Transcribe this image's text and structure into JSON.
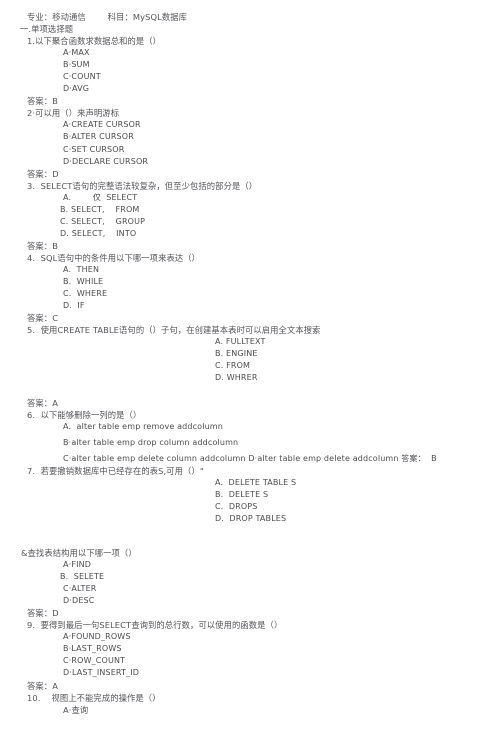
{
  "document": {
    "header": {
      "major_label": "专业：",
      "major_value": "移动通信",
      "subject_label": "科目：",
      "subject_value": "MySQL数据库",
      "full": "专业：移动通信        科目：MySQL数据库"
    },
    "section_title": "一.单项选择题",
    "answer_prefix": "答案：",
    "questions": [
      {
        "number": "1.",
        "stem": "1.以下聚合函数求数据总和的是（）",
        "options": [
          "A·MAX",
          "B·SUM",
          "C·COUNT",
          "D·AVG"
        ],
        "answer_line": "答案：B"
      },
      {
        "number": "2·",
        "stem": "2·可以用（）来声明游标",
        "options": [
          "A·CREATE CURSOR",
          "B·ALTER CURSOR",
          "C·SET CURSOR",
          "D·DECLARE CURSOR"
        ],
        "answer_line": "答案：D"
      },
      {
        "number": "3.",
        "stem": "3.  SELECT语句的完整语法较复杂，但至少包括的部分是（）",
        "options": [
          "A.        仅  SELECT",
          "B. SELECT,    FROM",
          "C. SELECT,    GROUP",
          "D. SELECT,    INTO"
        ],
        "answer_line": "答案：B"
      },
      {
        "number": "4.",
        "stem": "4.  SQL语句中的条件用以下哪一项来表达（）",
        "options": [
          "A.  THEN",
          "B.  WHILE",
          "C.  WHERE",
          "D.  IF"
        ],
        "answer_line": "答案：C"
      },
      {
        "number": "5.",
        "stem": "5.  使用CREATE TABLE语句的（）子句，在创建基本表时可以启用全文本搜索",
        "options": [
          "A. FULLTEXT",
          "B. ENGINE",
          "C. FROM",
          "D. WHRER"
        ],
        "answer_line": "答案：A"
      },
      {
        "number": "6.",
        "stem": "6.  以下能够删除一列的是（）",
        "options": [
          "A.  alter table emp remove addcolumn",
          "B·alter table emp drop column addcolumn",
          "C·alter table emp delete column addcolumn D·alter table emp delete addcolumn 答案：  B"
        ],
        "answer_line": ""
      },
      {
        "number": "7.",
        "stem": "7.  若要撤销数据库中已经存在的表S,可用（）\"",
        "options": [
          "A.  DELETE TABLE S",
          "B.  DELETE S",
          "C.  DROPS",
          "D.  DROP TABLES"
        ],
        "answer_line": ""
      },
      {
        "number": "&",
        "stem": "&查找表结构用以下哪一项（）",
        "options": [
          "A·FIND",
          "B.  SELETE",
          "C·ALTER",
          "D·DESC"
        ],
        "answer_line": "答案：D"
      },
      {
        "number": "9.",
        "stem": "9.  要得到最后一句SELECT查询到的总行数，可以使用的函数是（）",
        "options": [
          "A·FOUND_ROWS",
          "B·LAST_ROWS",
          "C·ROW_COUNT",
          "D·LAST_INSERT_ID"
        ],
        "answer_line": "答案：A"
      },
      {
        "number": "10.",
        "stem": "10.    视图上不能完成的操作是（）",
        "options": [
          "A·查询"
        ],
        "answer_line": ""
      }
    ]
  }
}
